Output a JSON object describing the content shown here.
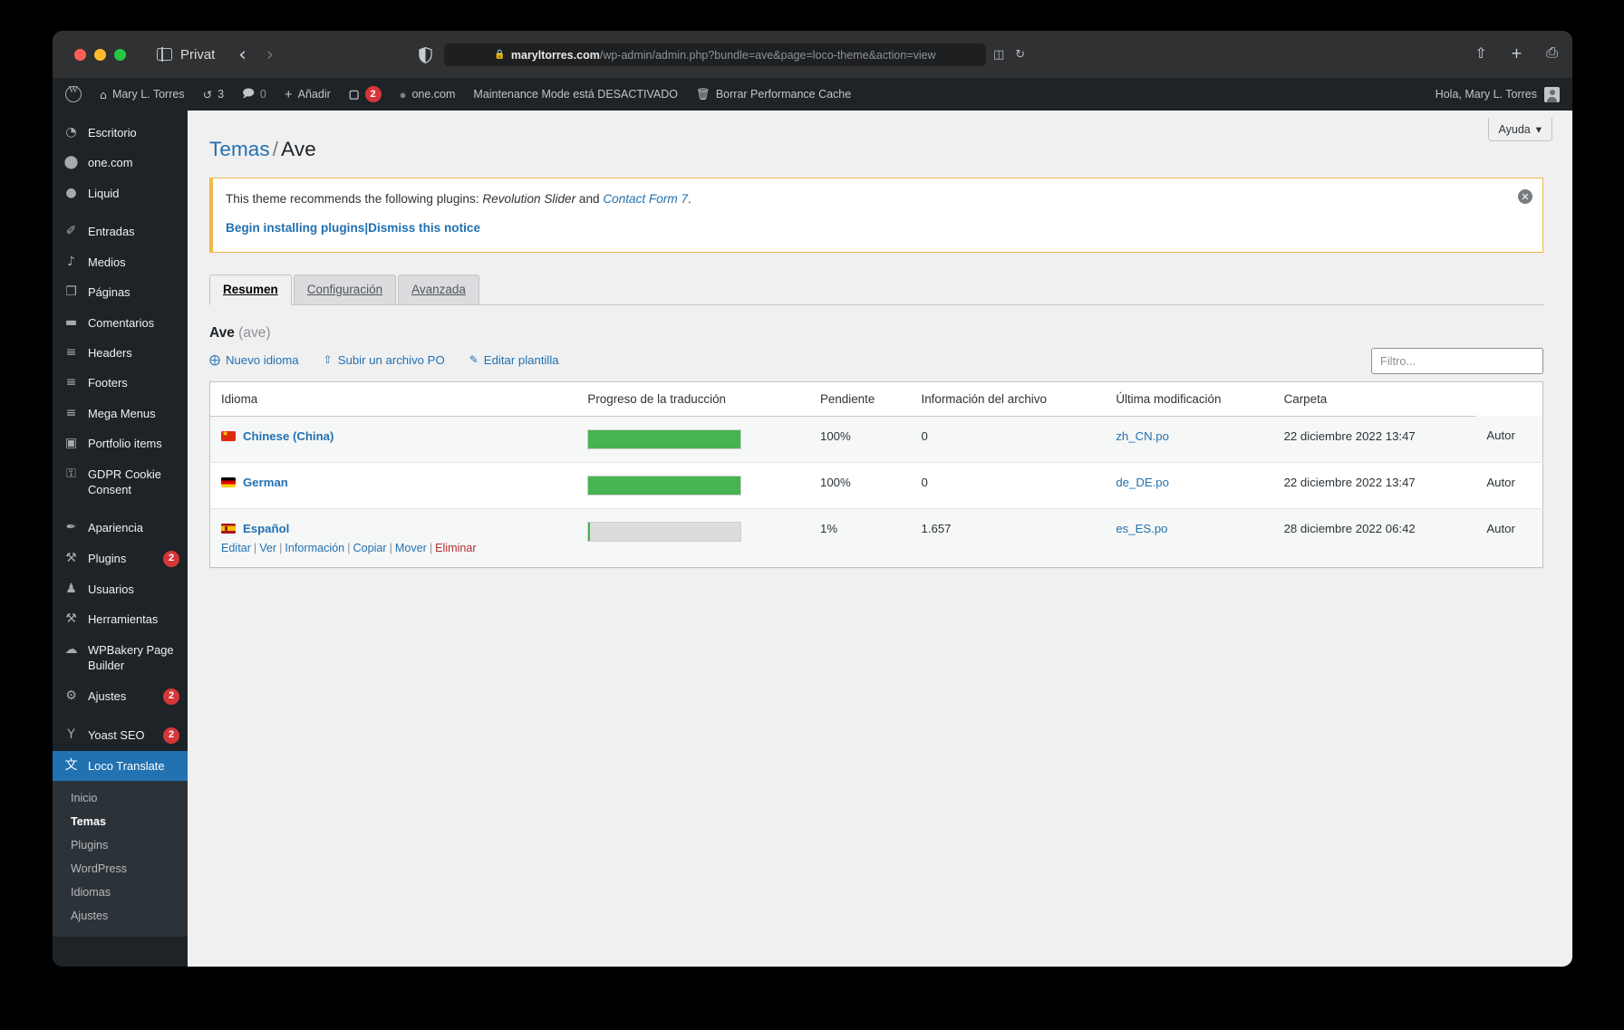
{
  "browser": {
    "private_label": "Privat",
    "url_domain": "maryltorres.com",
    "url_path": "/wp-admin/admin.php?bundle=ave&page=loco-theme&action=view",
    "lock_icon": "lock-icon",
    "back_icon": "chevron-left-icon",
    "forward_icon": "chevron-right-icon",
    "shield_icon": "shield-icon",
    "reader_icon": "reader-view-icon",
    "reload_icon": "reload-icon",
    "share_icon": "share-icon",
    "newtab_icon": "plus-icon",
    "tabs_icon": "tab-overview-icon"
  },
  "adminbar": {
    "wp_logo": "wordpress-logo-icon",
    "site_name": "Mary L. Torres",
    "updates_count": "3",
    "comments_count": "0",
    "new_label": "Añadir",
    "yoast_badge": "2",
    "onecom_label": "one.com",
    "maintenance_label": "Maintenance Mode está DESACTIVADO",
    "cache_label": "Borrar Performance Cache",
    "greeting": "Hola, Mary L. Torres"
  },
  "sidebar": {
    "items": [
      {
        "label": "Escritorio",
        "icon": "dashboard-icon",
        "glyph": "◔",
        "badge": ""
      },
      {
        "label": "one.com",
        "icon": "onecom-icon",
        "glyph": "⬤",
        "badge": ""
      },
      {
        "label": "Liquid",
        "icon": "liquid-drop-icon",
        "glyph": "●",
        "badge": ""
      },
      {
        "label": "Entradas",
        "icon": "pin-icon",
        "glyph": "✐",
        "badge": "",
        "gap": true
      },
      {
        "label": "Medios",
        "icon": "media-icon",
        "glyph": "♪",
        "badge": ""
      },
      {
        "label": "Páginas",
        "icon": "pages-icon",
        "glyph": "❐",
        "badge": ""
      },
      {
        "label": "Comentarios",
        "icon": "comments-icon",
        "glyph": "▬",
        "badge": ""
      },
      {
        "label": "Headers",
        "icon": "header-icon",
        "glyph": "≡",
        "badge": ""
      },
      {
        "label": "Footers",
        "icon": "footer-icon",
        "glyph": "≡",
        "badge": ""
      },
      {
        "label": "Mega Menus",
        "icon": "mega-menu-icon",
        "glyph": "≡",
        "badge": ""
      },
      {
        "label": "Portfolio items",
        "icon": "portfolio-image-icon",
        "glyph": "▣",
        "badge": ""
      },
      {
        "label": "GDPR Cookie Consent",
        "icon": "lock-icon",
        "glyph": "⚿",
        "badge": ""
      },
      {
        "label": "Apariencia",
        "icon": "appearance-brush-icon",
        "glyph": "✒",
        "badge": "",
        "gap": true
      },
      {
        "label": "Plugins",
        "icon": "plugin-icon",
        "glyph": "⚒",
        "badge": "2"
      },
      {
        "label": "Usuarios",
        "icon": "users-icon",
        "glyph": "♟",
        "badge": ""
      },
      {
        "label": "Herramientas",
        "icon": "tools-wrench-icon",
        "glyph": "⚒",
        "badge": ""
      },
      {
        "label": "WPBakery Page Builder",
        "icon": "wpbakery-icon",
        "glyph": "☁",
        "badge": ""
      },
      {
        "label": "Ajustes",
        "icon": "settings-sliders-icon",
        "glyph": "⚙",
        "badge": "2"
      },
      {
        "label": "Yoast SEO",
        "icon": "yoast-icon",
        "glyph": "Y",
        "badge": "2",
        "gap": true
      },
      {
        "label": "Loco Translate",
        "icon": "loco-translate-icon",
        "glyph": "文",
        "badge": "",
        "current": true
      }
    ],
    "submenu": [
      {
        "label": "Inicio",
        "current": false
      },
      {
        "label": "Temas",
        "current": true
      },
      {
        "label": "Plugins",
        "current": false
      },
      {
        "label": "WordPress",
        "current": false
      },
      {
        "label": "Idiomas",
        "current": false
      },
      {
        "label": "Ajustes",
        "current": false
      }
    ]
  },
  "help_tab": {
    "label": "Ayuda",
    "caret": "▾"
  },
  "page": {
    "breadcrumb_root": "Temas",
    "breadcrumb_sep": "/",
    "breadcrumb_current": "Ave"
  },
  "notice": {
    "text_before": "This theme recommends the following plugins: ",
    "plugin_1": "Revolution Slider",
    "conjunction": " and ",
    "plugin_2": "Contact Form 7",
    "text_after": ".",
    "link_install": "Begin installing plugins",
    "link_sep": "|",
    "link_dismiss": "Dismiss this notice",
    "dismiss_icon": "close-circle-icon"
  },
  "tabs": [
    {
      "label": "Resumen",
      "active": true
    },
    {
      "label": "Configuración",
      "active": false
    },
    {
      "label": "Avanzada",
      "active": false
    }
  ],
  "bundle": {
    "name": "Ave",
    "slug": "(ave)"
  },
  "toolbar": {
    "new_language": "Nuevo idioma",
    "new_language_icon": "plus-circle-icon",
    "upload_po": "Subir un archivo PO",
    "upload_po_icon": "upload-icon",
    "edit_template": "Editar plantilla",
    "edit_template_icon": "pencil-icon",
    "filter_placeholder": "Filtro..."
  },
  "table": {
    "columns": [
      "Idioma",
      "Progreso de la traducción",
      "Pendiente",
      "Información del archivo",
      "Última modificación",
      "Carpeta"
    ],
    "rows": [
      {
        "language": "Chinese (China)",
        "flag": "flag-cn",
        "progress_pct": "100%",
        "progress_value": 100,
        "pending": "0",
        "file": "zh_CN.po",
        "modified": "22 diciembre 2022 13:47",
        "folder": "Autor",
        "actions": []
      },
      {
        "language": "German",
        "flag": "flag-de",
        "progress_pct": "100%",
        "progress_value": 100,
        "pending": "0",
        "file": "de_DE.po",
        "modified": "22 diciembre 2022 13:47",
        "folder": "Autor",
        "actions": []
      },
      {
        "language": "Español",
        "flag": "flag-es",
        "progress_pct": "1%",
        "progress_value": 1,
        "pending": "1.657",
        "file": "es_ES.po",
        "modified": "28 diciembre 2022 06:42",
        "folder": "Autor",
        "actions": [
          "Editar",
          "Ver",
          "Información",
          "Copiar",
          "Mover",
          "Eliminar"
        ]
      }
    ]
  },
  "colors": {
    "accent": "#2271b1",
    "progress_green": "#46b450",
    "notice_border": "#f0b849",
    "danger": "#b32d2e",
    "admin_dark": "#1d2327"
  }
}
